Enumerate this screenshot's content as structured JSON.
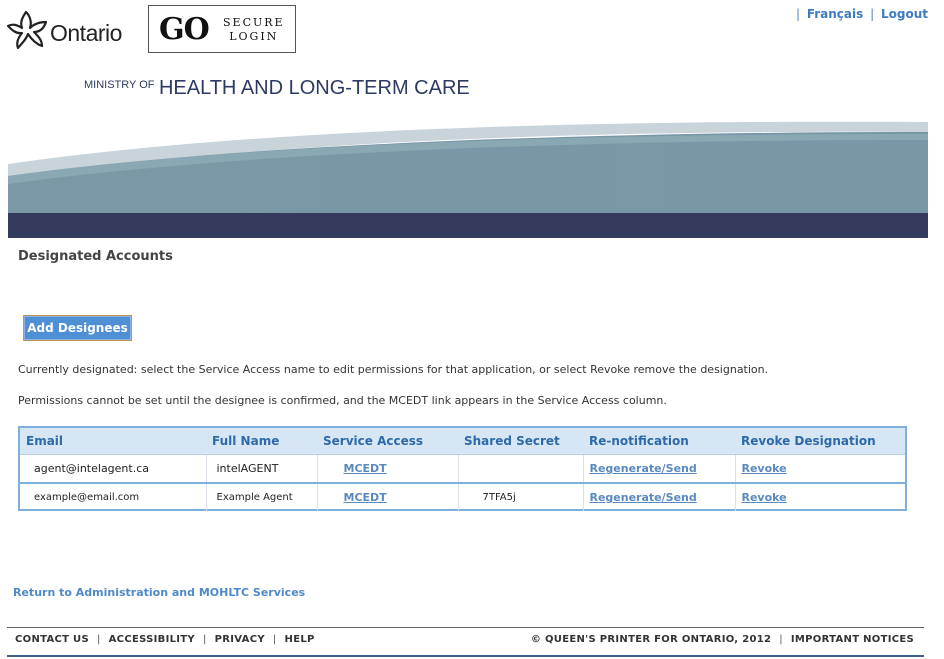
{
  "header": {
    "ontario": "Ontario",
    "go": "GO",
    "secure": "SECURE",
    "login": "LOGIN",
    "links": [
      "Français",
      "Logout"
    ],
    "ministry_small": "MINISTRY OF",
    "ministry_big": "HEALTH AND LONG-TERM CARE"
  },
  "page": {
    "title": "Designated Accounts",
    "add_button": "Add Designees",
    "info1": "Currently designated: select the Service Access name to edit permissions for that application, or select Revoke remove the designation.",
    "info2": "Permissions cannot be set until the designee is confirmed, and the MCEDT link appears in the Service Access column."
  },
  "table": {
    "headers": [
      "Email",
      "Full Name",
      "Service Access",
      "Shared Secret",
      "Re-notification",
      "Revoke Designation"
    ],
    "rows": [
      {
        "email": "agent@intelagent.ca",
        "name": "intelAGENT",
        "service": "MCEDT",
        "secret": "",
        "renotify": "Regenerate/Send",
        "revoke": "Revoke"
      },
      {
        "email": "example@email.com",
        "name": "Example Agent",
        "service": "MCEDT",
        "secret": "7TFA5j",
        "renotify": "Regenerate/Send",
        "revoke": "Revoke"
      }
    ]
  },
  "return_link": "Return to Administration and MOHLTC Services",
  "footer": {
    "left": [
      "CONTACT US",
      "ACCESSIBILITY",
      "PRIVACY",
      "HELP"
    ],
    "copyright": "© QUEEN'S PRINTER FOR ONTARIO, 2012",
    "notices": "IMPORTANT NOTICES"
  },
  "colors": {
    "accent": "#4f8fd6",
    "navy": "#2d3a63",
    "table_border": "#7fb0dc"
  }
}
